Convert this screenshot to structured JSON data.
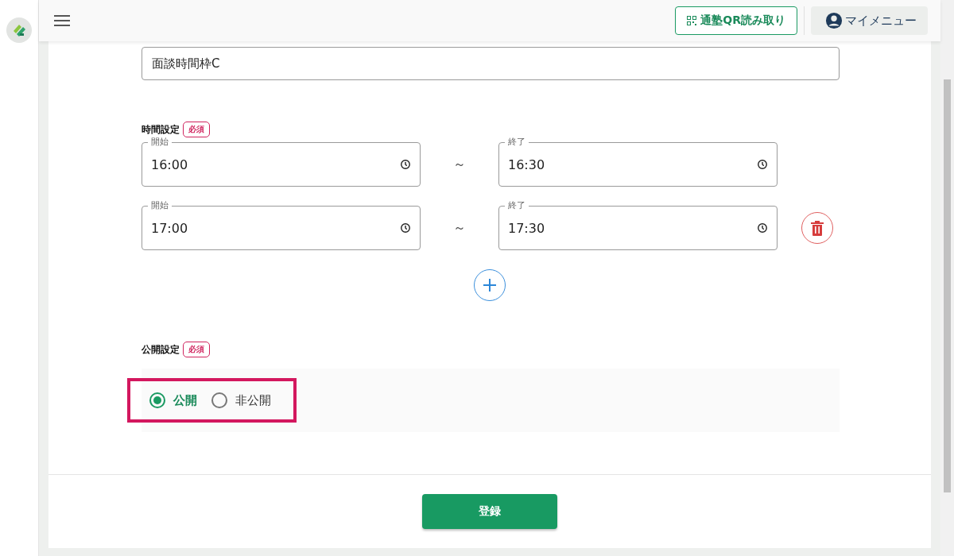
{
  "header": {
    "qr_button": "通塾QR読み取り",
    "menu_button": "マイメニュー"
  },
  "name_field": {
    "value": "面談時間枠C"
  },
  "time_section": {
    "label": "時間設定",
    "required": "必須",
    "rows": [
      {
        "start_label": "開始",
        "start": "16:00",
        "separator": "～",
        "end_label": "終了",
        "end": "16:30",
        "deletable": false
      },
      {
        "start_label": "開始",
        "start": "17:00",
        "separator": "～",
        "end_label": "終了",
        "end": "17:30",
        "deletable": true
      }
    ]
  },
  "publish_section": {
    "label": "公開設定",
    "required": "必須",
    "highlighted": true,
    "options": [
      {
        "label": "公開",
        "selected": true
      },
      {
        "label": "非公開",
        "selected": false
      }
    ]
  },
  "submit_button": "登録"
}
